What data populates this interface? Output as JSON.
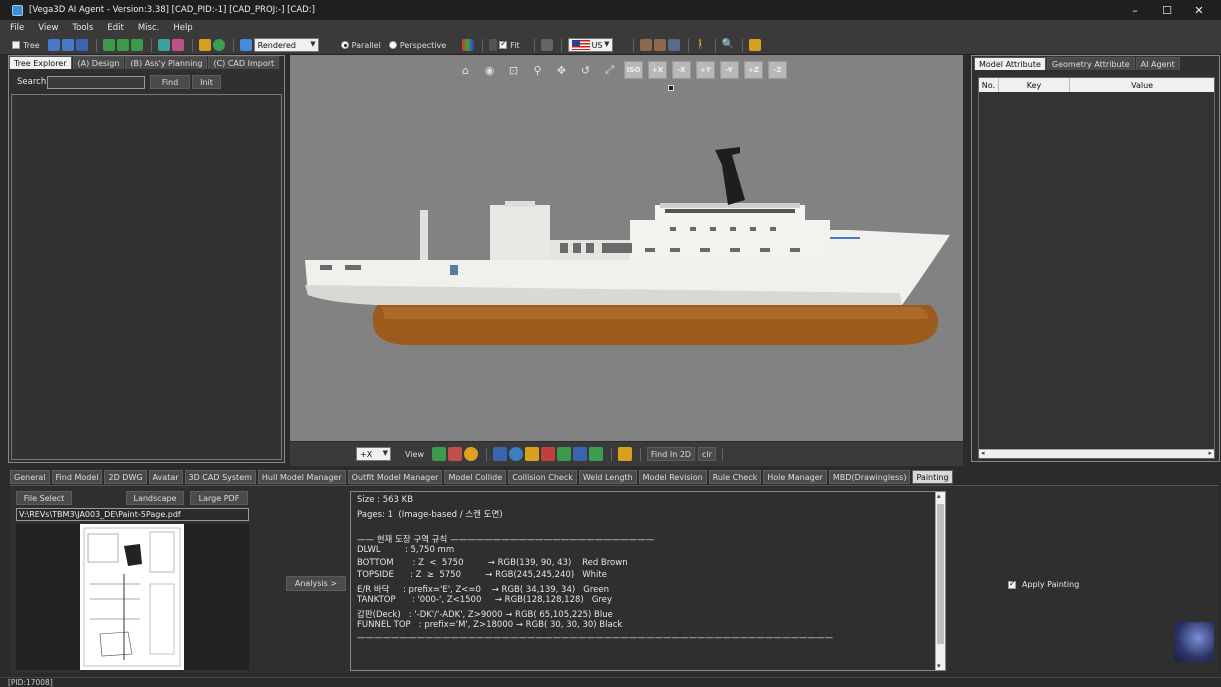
{
  "window": {
    "title": "[Vega3D AI Agent - Version:3.38] [CAD_PID:-1] [CAD_PROJ:-] [CAD:]"
  },
  "menu": [
    "File",
    "View",
    "Tools",
    "Edit",
    "Misc.",
    "Help"
  ],
  "toolbar": {
    "tree_label": "Tree",
    "render_mode": "Rendered",
    "parallel_label": "Parallel",
    "perspective_label": "Perspective",
    "fit_label": "Fit",
    "locale": "US"
  },
  "left_panel": {
    "tabs": [
      "Tree Explorer",
      "(A) Design",
      "(B) Ass'y Planning",
      "(C) CAD Import"
    ],
    "search_label": "Search",
    "find_label": "Find",
    "init_label": "Init"
  },
  "viewport": {
    "view_buttons": [
      "ISO",
      "+X",
      "-X",
      "+Y",
      "-Y",
      "+Z",
      "-Z"
    ],
    "bottom": {
      "axis": "+X",
      "view_label": "View",
      "find_2d_label": "Find In 2D",
      "clr_label": "clr"
    }
  },
  "right_panel": {
    "tabs": [
      "Model Attribute",
      "Geometry Attribute",
      "AI Agent"
    ],
    "columns": [
      "No.",
      "Key",
      "Value"
    ]
  },
  "bottom_tabs": [
    "General",
    "Find Model",
    "2D DWG",
    "Avatar",
    "3D CAD System",
    "Hull Model Manager",
    "Outfit Model Manager",
    "Model Collide",
    "Collision Check",
    "Weld Length",
    "Model Revision",
    "Rule Check",
    "Hole Manager",
    "MBD(Drawingless)",
    "Painting"
  ],
  "painting": {
    "file_select_label": "File Select",
    "landscape_label": "Landscape",
    "large_pdf_label": "Large PDF",
    "file_path": "V:\\REVs\\TBM3\\JA003_DE\\Paint-5Page.pdf",
    "analysis_label": "Analysis >",
    "apply_label": "Apply Painting",
    "log_lines": [
      "Size : 563 KB",
      "Pages: 1  (Image-based / 스캔 도면)",
      "",
      "—— 현재 도장 구역 규칙 ————————————————————————",
      "DLWL         : 5,750 mm",
      "BOTTOM       : Z  <  5750         → RGB(139, 90, 43)    Red Brown",
      "TOPSIDE      : Z  ≥  5750         → RGB(245,245,240)   White",
      "E/R 바닥     : prefix='E', Z<=0    → RGB( 34,139, 34)   Green",
      "TANKTOP      : '000-', Z<1500     → RGB(128,128,128)   Grey",
      "갑판(Deck)   : '-DK'/'-ADK', Z>9000 → RGB( 65,105,225) Blue",
      "FUNNEL TOP   : prefix='M', Z>18000 → RGB( 30, 30, 30) Black",
      "————————————————————————————————————————————————————————"
    ]
  },
  "status": {
    "pid": "[PID:17008]"
  },
  "colors": {
    "hull_bottom": "#9c5a1c",
    "topside": "#f2f2ee",
    "funnel": "#1e1e1e",
    "viewport_bg": "#828282"
  }
}
